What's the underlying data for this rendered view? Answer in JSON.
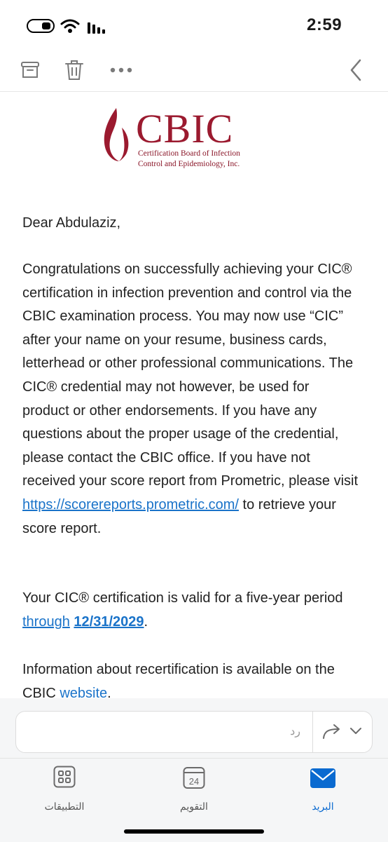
{
  "status_bar": {
    "time": "2:59"
  },
  "logo": {
    "name": "CBIC",
    "line1": "Certification Board of Infection",
    "line2": "Control and Epidemiology, Inc."
  },
  "email": {
    "greeting": "Dear Abdulaziz,",
    "body_text": "Congratulations on successfully achieving your CIC® certification in infection prevention and control via the CBIC examination process. You may now use “CIC” after your name on your resume, business cards, letterhead or other professional communications. The CIC® credential may not however, be used for product or other endorsements. If you have any questions about the proper usage of the credential, please contact the CBIC office. If you have not received your score report from Prometric, please visit",
    "link_url": "https://scorereports.prometric.com/",
    "body_after_link": "to retrieve your score report.",
    "validity_text": "Your CIC® certification is valid for a five-year period",
    "validity_link_word": "through",
    "validity_date": "12/31/2029",
    "validity_end": ".",
    "recert_text": "Information about recertification is available on the CBIC",
    "recert_link": "website",
    "recert_end": "."
  },
  "reply": {
    "placeholder": "رد"
  },
  "tabs": [
    {
      "label": "التطبيقات",
      "icon": "apps-icon"
    },
    {
      "label": "التقويم",
      "icon": "calendar-icon",
      "day": "24"
    },
    {
      "label": "البريد",
      "icon": "mail-icon",
      "active": true
    }
  ],
  "colors": {
    "accent": "#0a6ad0",
    "link": "#1a73c9",
    "brand": "#9b1a2f"
  }
}
